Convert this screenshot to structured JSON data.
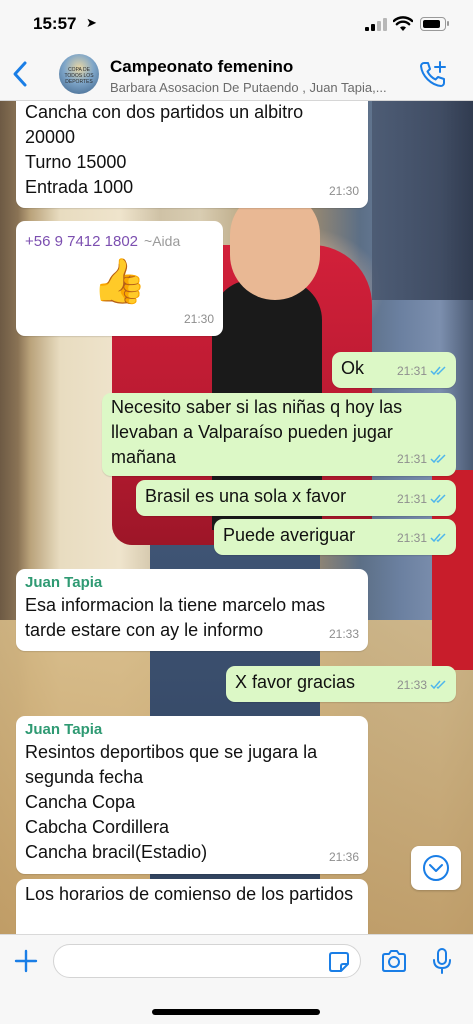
{
  "status_bar": {
    "time": "15:57",
    "location_icon": "location-arrow-icon"
  },
  "header": {
    "title": "Campeonato femenino",
    "subtitle": "Barbara Asosacion De Putaendo , Juan Tapia,...",
    "avatar_text": "COPA DE TODOS LOS DEPORTES",
    "back_icon": "chevron-left-icon",
    "call_icon": "add-call-icon"
  },
  "colors": {
    "accent": "#1a7ee6",
    "outgoing_bubble": "#dcf8c6",
    "incoming_bubble": "#ffffff",
    "sender_name": "#2f9a73",
    "phone_name": "#7c4fb0",
    "read_ticks": "#4fb6ec"
  },
  "messages": [
    {
      "direction": "in",
      "text": "Cancha con dos partidos un albitro\n20000\nTurno 15000\nEntrada 1000",
      "time": "21:30"
    },
    {
      "direction": "in",
      "sender_phone": "+56 9 7412 1802",
      "sender_alias": "~Aida",
      "text": "👍",
      "time": "21:30"
    },
    {
      "direction": "out",
      "text": "Ok",
      "time": "21:31",
      "read": true
    },
    {
      "direction": "out",
      "text": "Necesito saber si las niñas q hoy las llevaban a Valparaíso pueden jugar mañana",
      "time": "21:31",
      "read": true
    },
    {
      "direction": "out",
      "text": "Brasil es una sola x favor",
      "time": "21:31",
      "read": true
    },
    {
      "direction": "out",
      "text": "Puede averiguar",
      "time": "21:31",
      "read": true
    },
    {
      "direction": "in",
      "sender": "Juan Tapia",
      "text": "Esa informacion la tiene marcelo mas tarde estare con ay le informo",
      "time": "21:33"
    },
    {
      "direction": "out",
      "text": "X favor gracias",
      "time": "21:33",
      "read": true
    },
    {
      "direction": "in",
      "sender": "Juan Tapia",
      "text": "Resintos deportibos que se jugara la segunda fecha\nCancha Copa\nCabcha Cordillera\nCancha bracil(Estadio)",
      "time": "21:36"
    },
    {
      "direction": "in",
      "text": "Los horarios de comienso de los partidos",
      "time": ""
    }
  ],
  "input": {
    "placeholder": "",
    "value": ""
  }
}
